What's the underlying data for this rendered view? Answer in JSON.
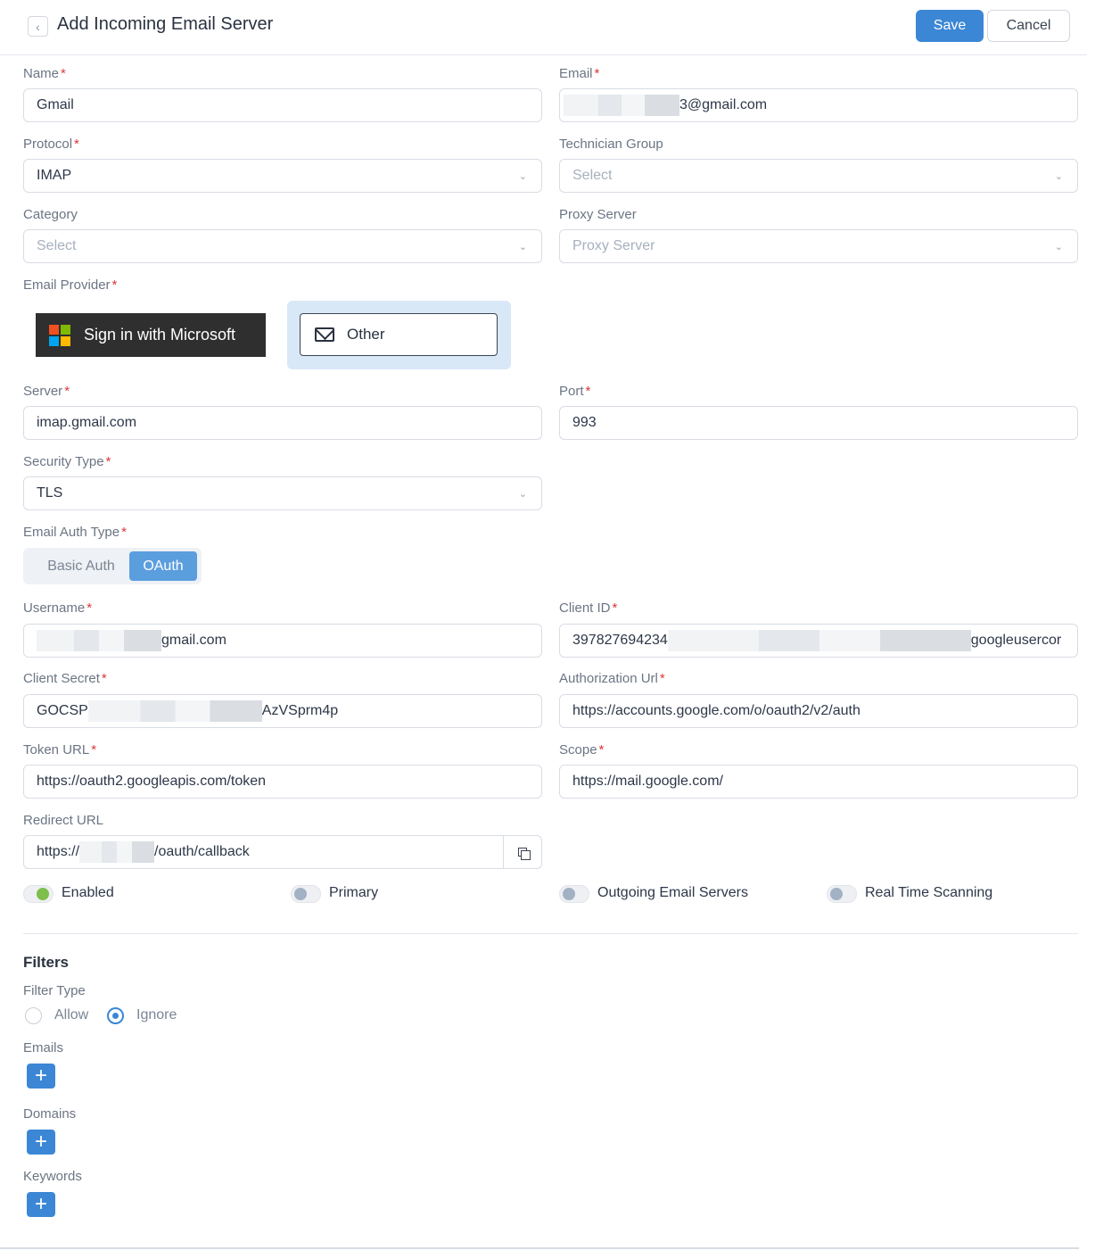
{
  "header": {
    "title": "Add Incoming Email Server",
    "save_label": "Save",
    "cancel_label": "Cancel"
  },
  "form": {
    "name": {
      "label": "Name",
      "value": "Gmail"
    },
    "email": {
      "label": "Email",
      "value_suffix": "3@gmail.com"
    },
    "protocol": {
      "label": "Protocol",
      "value": "IMAP"
    },
    "technician_group": {
      "label": "Technician Group",
      "placeholder": "Select"
    },
    "category": {
      "label": "Category",
      "placeholder": "Select"
    },
    "proxy_server": {
      "label": "Proxy Server",
      "placeholder": "Proxy Server"
    },
    "email_provider": {
      "label": "Email Provider",
      "microsoft_label": "Sign in with Microsoft",
      "other_label": "Other",
      "selected": "Other"
    },
    "server": {
      "label": "Server",
      "value": "imap.gmail.com"
    },
    "port": {
      "label": "Port",
      "value": "993"
    },
    "security_type": {
      "label": "Security Type",
      "value": "TLS"
    },
    "auth_type": {
      "label": "Email Auth Type",
      "basic_label": "Basic Auth",
      "oauth_label": "OAuth",
      "selected": "OAuth"
    },
    "username": {
      "label": "Username",
      "value_suffix": "gmail.com"
    },
    "client_id": {
      "label": "Client ID",
      "value_prefix": "397827694234",
      "value_suffix": "googleusercor"
    },
    "client_secret": {
      "label": "Client Secret",
      "value_prefix": "GOCSP",
      "value_suffix": "AzVSprm4p"
    },
    "authorization_url": {
      "label": "Authorization Url",
      "value": "https://accounts.google.com/o/oauth2/v2/auth"
    },
    "token_url": {
      "label": "Token URL",
      "value": "https://oauth2.googleapis.com/token"
    },
    "scope": {
      "label": "Scope",
      "value": "https://mail.google.com/"
    },
    "redirect_url": {
      "label": "Redirect URL",
      "value_prefix": "https://",
      "value_suffix": "/oauth/callback"
    }
  },
  "toggles": [
    {
      "label": "Enabled",
      "on": true
    },
    {
      "label": "Primary",
      "on": false
    },
    {
      "label": "Outgoing Email Servers",
      "on": false
    },
    {
      "label": "Real Time Scanning",
      "on": false
    }
  ],
  "filters": {
    "title": "Filters",
    "filter_type_label": "Filter Type",
    "allow_label": "Allow",
    "ignore_label": "Ignore",
    "selected": "Ignore",
    "emails_label": "Emails",
    "domains_label": "Domains",
    "keywords_label": "Keywords"
  },
  "colors": {
    "accent": "#3b87d6",
    "required": "#d9383a",
    "toggle_on": "#7dbf4a"
  },
  "icons": {
    "back": "chevron-left-icon",
    "copy": "copy-icon",
    "add": "plus-icon",
    "mail": "envelope-icon"
  }
}
